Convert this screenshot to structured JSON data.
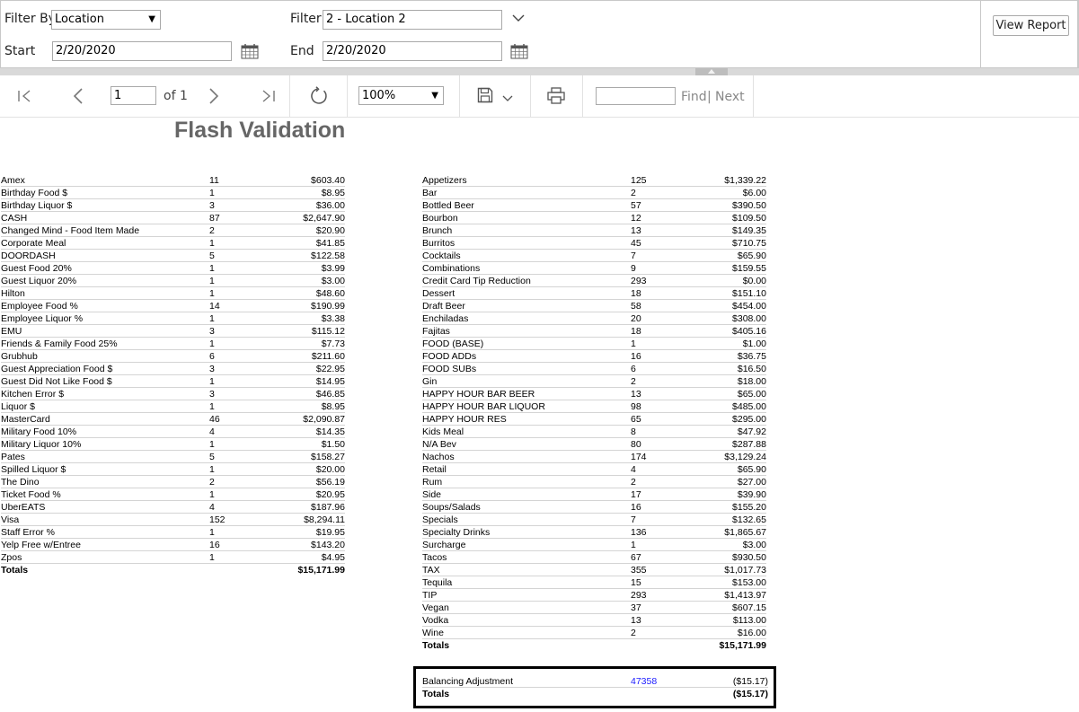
{
  "params": {
    "filter_by_label": "Filter By",
    "filter_by_value": "Location",
    "filter_label": "Filter",
    "filter_value": "2 - Location 2",
    "start_label": "Start",
    "start_value": "2/20/2020",
    "end_label": "End",
    "end_value": "2/20/2020",
    "view_report_label": "View Report"
  },
  "toolbar": {
    "page_value": "1",
    "page_of": "of 1",
    "zoom_value": "100%",
    "find_placeholder": "",
    "find_label": "Find",
    "separator": "|",
    "next_label": "Next"
  },
  "report": {
    "title": "Flash Validation",
    "left_table": [
      {
        "name": "Amex",
        "count": "11",
        "amount": "$603.40"
      },
      {
        "name": "Birthday Food $",
        "count": "1",
        "amount": "$8.95"
      },
      {
        "name": "Birthday Liquor $",
        "count": "3",
        "amount": "$36.00"
      },
      {
        "name": "CASH",
        "count": "87",
        "amount": "$2,647.90"
      },
      {
        "name": "Changed Mind - Food Item Made",
        "count": "2",
        "amount": "$20.90"
      },
      {
        "name": "Corporate Meal",
        "count": "1",
        "amount": "$41.85"
      },
      {
        "name": "DOORDASH",
        "count": "5",
        "amount": "$122.58"
      },
      {
        "name": "Guest Food 20%",
        "count": "1",
        "amount": "$3.99"
      },
      {
        "name": "Guest Liquor 20%",
        "count": "1",
        "amount": "$3.00"
      },
      {
        "name": "Hilton",
        "count": "1",
        "amount": "$48.60"
      },
      {
        "name": "Employee Food %",
        "count": "14",
        "amount": "$190.99"
      },
      {
        "name": "Employee Liquor %",
        "count": "1",
        "amount": "$3.38"
      },
      {
        "name": "EMU",
        "count": "3",
        "amount": "$115.12"
      },
      {
        "name": "Friends & Family Food 25%",
        "count": "1",
        "amount": "$7.73"
      },
      {
        "name": "Grubhub",
        "count": "6",
        "amount": "$211.60"
      },
      {
        "name": "Guest Appreciation Food $",
        "count": "3",
        "amount": "$22.95"
      },
      {
        "name": "Guest Did Not Like Food $",
        "count": "1",
        "amount": "$14.95"
      },
      {
        "name": "Kitchen Error $",
        "count": "3",
        "amount": "$46.85"
      },
      {
        "name": "Liquor $",
        "count": "1",
        "amount": "$8.95"
      },
      {
        "name": "MasterCard",
        "count": "46",
        "amount": "$2,090.87"
      },
      {
        "name": "Military Food 10%",
        "count": "4",
        "amount": "$14.35"
      },
      {
        "name": "Military Liquor 10%",
        "count": "1",
        "amount": "$1.50"
      },
      {
        "name": "Pates",
        "count": "5",
        "amount": "$158.27"
      },
      {
        "name": "Spilled Liquor $",
        "count": "1",
        "amount": "$20.00"
      },
      {
        "name": "The Dino",
        "count": "2",
        "amount": "$56.19"
      },
      {
        "name": "Ticket Food %",
        "count": "1",
        "amount": "$20.95"
      },
      {
        "name": "UberEATS",
        "count": "4",
        "amount": "$187.96"
      },
      {
        "name": "Visa",
        "count": "152",
        "amount": "$8,294.11"
      },
      {
        "name": "Staff Error %",
        "count": "1",
        "amount": "$19.95"
      },
      {
        "name": "Yelp Free w/Entree",
        "count": "16",
        "amount": "$143.20"
      },
      {
        "name": "Zpos",
        "count": "1",
        "amount": "$4.95"
      }
    ],
    "left_total": {
      "name": "Totals",
      "count": "",
      "amount": "$15,171.99"
    },
    "right_table": [
      {
        "name": "Appetizers",
        "count": "125",
        "amount": "$1,339.22"
      },
      {
        "name": "Bar",
        "count": "2",
        "amount": "$6.00"
      },
      {
        "name": "Bottled Beer",
        "count": "57",
        "amount": "$390.50"
      },
      {
        "name": "Bourbon",
        "count": "12",
        "amount": "$109.50"
      },
      {
        "name": "Brunch",
        "count": "13",
        "amount": "$149.35"
      },
      {
        "name": "Burritos",
        "count": "45",
        "amount": "$710.75"
      },
      {
        "name": "Cocktails",
        "count": "7",
        "amount": "$65.90"
      },
      {
        "name": "Combinations",
        "count": "9",
        "amount": "$159.55"
      },
      {
        "name": "Credit Card Tip Reduction",
        "count": "293",
        "amount": "$0.00"
      },
      {
        "name": "Dessert",
        "count": "18",
        "amount": "$151.10"
      },
      {
        "name": "Draft Beer",
        "count": "58",
        "amount": "$454.00"
      },
      {
        "name": "Enchiladas",
        "count": "20",
        "amount": "$308.00"
      },
      {
        "name": "Fajitas",
        "count": "18",
        "amount": "$405.16"
      },
      {
        "name": "FOOD (BASE)",
        "count": "1",
        "amount": "$1.00"
      },
      {
        "name": "FOOD ADDs",
        "count": "16",
        "amount": "$36.75"
      },
      {
        "name": "FOOD SUBs",
        "count": "6",
        "amount": "$16.50"
      },
      {
        "name": "Gin",
        "count": "2",
        "amount": "$18.00"
      },
      {
        "name": "HAPPY HOUR BAR BEER",
        "count": "13",
        "amount": "$65.00"
      },
      {
        "name": "HAPPY HOUR BAR LIQUOR",
        "count": "98",
        "amount": "$485.00"
      },
      {
        "name": "HAPPY HOUR RES",
        "count": "65",
        "amount": "$295.00"
      },
      {
        "name": "Kids Meal",
        "count": "8",
        "amount": "$47.92"
      },
      {
        "name": "N/A Bev",
        "count": "80",
        "amount": "$287.88"
      },
      {
        "name": "Nachos",
        "count": "174",
        "amount": "$3,129.24"
      },
      {
        "name": "Retail",
        "count": "4",
        "amount": "$65.90"
      },
      {
        "name": "Rum",
        "count": "2",
        "amount": "$27.00"
      },
      {
        "name": "Side",
        "count": "17",
        "amount": "$39.90"
      },
      {
        "name": "Soups/Salads",
        "count": "16",
        "amount": "$155.20"
      },
      {
        "name": "Specials",
        "count": "7",
        "amount": "$132.65"
      },
      {
        "name": "Specialty Drinks",
        "count": "136",
        "amount": "$1,865.67"
      },
      {
        "name": "Surcharge",
        "count": "1",
        "amount": "$3.00"
      },
      {
        "name": "Tacos",
        "count": "67",
        "amount": "$930.50"
      },
      {
        "name": "TAX",
        "count": "355",
        "amount": "$1,017.73"
      },
      {
        "name": "Tequila",
        "count": "15",
        "amount": "$153.00"
      },
      {
        "name": "TIP",
        "count": "293",
        "amount": "$1,413.97"
      },
      {
        "name": "Vegan",
        "count": "37",
        "amount": "$607.15"
      },
      {
        "name": "Vodka",
        "count": "13",
        "amount": "$113.00"
      },
      {
        "name": "Wine",
        "count": "2",
        "amount": "$16.00"
      }
    ],
    "right_total": {
      "name": "Totals",
      "count": "",
      "amount": "$15,171.99"
    },
    "balance": {
      "name": "Balancing Adjustment",
      "count": "47358",
      "amount": "($15.17)"
    },
    "balance_total": {
      "name": "Totals",
      "count": "",
      "amount": "($15.17)"
    }
  }
}
